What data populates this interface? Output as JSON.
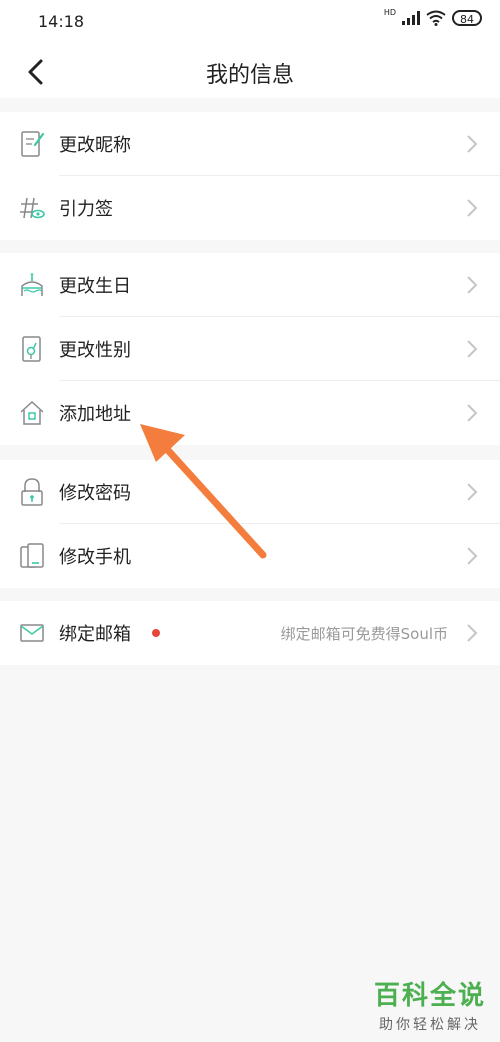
{
  "status": {
    "time": "14:18",
    "hd": "HD",
    "battery": "84"
  },
  "navbar": {
    "title": "我的信息"
  },
  "groups": [
    {
      "items": [
        {
          "label": "更改昵称",
          "icon": "edit-icon"
        },
        {
          "label": "引力签",
          "icon": "hashtag-icon"
        }
      ]
    },
    {
      "items": [
        {
          "label": "更改生日",
          "icon": "cake-icon"
        },
        {
          "label": "更改性别",
          "icon": "gender-icon"
        },
        {
          "label": "添加地址",
          "icon": "house-icon"
        }
      ]
    },
    {
      "items": [
        {
          "label": "修改密码",
          "icon": "lock-icon"
        },
        {
          "label": "修改手机",
          "icon": "phone-icon"
        }
      ]
    },
    {
      "items": [
        {
          "label": "绑定邮箱",
          "icon": "mail-icon",
          "hint": "绑定邮箱可免费得Soul币",
          "has_red_dot": true
        }
      ]
    }
  ],
  "colors": {
    "accent": "#3cc8a8",
    "arrow": "#f47c3c",
    "red_dot": "#e8453c",
    "watermark": "#4caf50"
  },
  "watermark": {
    "title": "百科全说",
    "subtitle": "助你轻松解决"
  }
}
